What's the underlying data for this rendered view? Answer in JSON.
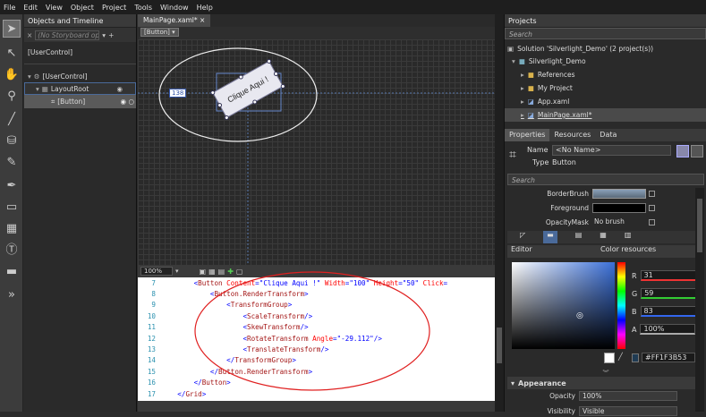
{
  "menu": [
    "File",
    "Edit",
    "View",
    "Object",
    "Project",
    "Tools",
    "Window",
    "Help"
  ],
  "objects_panel": {
    "title": "Objects and Timeline",
    "storyboard": "(No Storyboard open)",
    "root": "[UserControl]",
    "tree": [
      "[UserControl]",
      "LayoutRoot",
      "[Button]"
    ]
  },
  "document": {
    "tab": "MainPage.xaml*",
    "breadcrumb": "[Button]",
    "button_text": "Clique Aqui !",
    "margin_value": "138",
    "zoom": "100%"
  },
  "code_lines": [
    {
      "n": "7",
      "indent": "        ",
      "parts": [
        [
          "t",
          "<"
        ],
        [
          "e",
          "Button"
        ],
        [
          "a",
          " Content"
        ],
        [
          "t",
          "="
        ],
        [
          "v",
          "\"Clique Aqui !\""
        ],
        [
          "a",
          " Width"
        ],
        [
          "t",
          "="
        ],
        [
          "v",
          "\"100\""
        ],
        [
          "a",
          " Height"
        ],
        [
          "t",
          "="
        ],
        [
          "v",
          "\"50\""
        ],
        [
          "a",
          " Click"
        ],
        [
          "t",
          "="
        ]
      ]
    },
    {
      "n": "8",
      "indent": "            ",
      "parts": [
        [
          "t",
          "<"
        ],
        [
          "e",
          "Button.RenderTransform"
        ],
        [
          "t",
          ">"
        ]
      ]
    },
    {
      "n": "9",
      "indent": "                ",
      "parts": [
        [
          "t",
          "<"
        ],
        [
          "e",
          "TransformGroup"
        ],
        [
          "t",
          ">"
        ]
      ]
    },
    {
      "n": "10",
      "indent": "                    ",
      "parts": [
        [
          "t",
          "<"
        ],
        [
          "e",
          "ScaleTransform"
        ],
        [
          "t",
          "/>"
        ]
      ]
    },
    {
      "n": "11",
      "indent": "                    ",
      "parts": [
        [
          "t",
          "<"
        ],
        [
          "e",
          "SkewTransform"
        ],
        [
          "t",
          "/>"
        ]
      ]
    },
    {
      "n": "12",
      "indent": "                    ",
      "parts": [
        [
          "t",
          "<"
        ],
        [
          "e",
          "RotateTransform"
        ],
        [
          "a",
          " Angle"
        ],
        [
          "t",
          "="
        ],
        [
          "v",
          "\"-29.112\""
        ],
        [
          "t",
          "/>"
        ]
      ]
    },
    {
      "n": "13",
      "indent": "                    ",
      "parts": [
        [
          "t",
          "<"
        ],
        [
          "e",
          "TranslateTransform"
        ],
        [
          "t",
          "/>"
        ]
      ]
    },
    {
      "n": "14",
      "indent": "                ",
      "parts": [
        [
          "t",
          "</"
        ],
        [
          "e",
          "TransformGroup"
        ],
        [
          "t",
          ">"
        ]
      ]
    },
    {
      "n": "15",
      "indent": "            ",
      "parts": [
        [
          "t",
          "</"
        ],
        [
          "e",
          "Button.RenderTransform"
        ],
        [
          "t",
          ">"
        ]
      ]
    },
    {
      "n": "16",
      "indent": "        ",
      "parts": [
        [
          "t",
          "</"
        ],
        [
          "e",
          "Button"
        ],
        [
          "t",
          ">"
        ]
      ]
    },
    {
      "n": "17",
      "indent": "    ",
      "parts": [
        [
          "t",
          "</"
        ],
        [
          "e",
          "Grid"
        ],
        [
          "t",
          ">"
        ]
      ]
    }
  ],
  "projects": {
    "title": "Projects",
    "search": "Search",
    "solution": "Solution 'Silverlight_Demo' (2 project(s))",
    "items": [
      "Silverlight_Demo",
      "References",
      "My Project",
      "App.xaml",
      "MainPage.xaml*"
    ]
  },
  "properties": {
    "tabs": [
      "Properties",
      "Resources",
      "Data"
    ],
    "name_label": "Name",
    "name_value": "<No Name>",
    "type_label": "Type",
    "type_value": "Button",
    "search": "Search",
    "rows": [
      {
        "label": "BorderBrush",
        "value": ""
      },
      {
        "label": "Foreground",
        "value": ""
      },
      {
        "label": "OpacityMask",
        "value": "No brush"
      }
    ],
    "editor_label": "Editor",
    "color_resources_label": "Color resources",
    "rgba": [
      {
        "k": "R",
        "v": "31"
      },
      {
        "k": "G",
        "v": "59"
      },
      {
        "k": "B",
        "v": "83"
      },
      {
        "k": "A",
        "v": "100%"
      }
    ],
    "hex": "#FF1F3B53",
    "appearance": "Appearance",
    "opacity_label": "Opacity",
    "opacity_value": "100%",
    "visibility_label": "Visibility",
    "visibility_value": "Visible"
  }
}
